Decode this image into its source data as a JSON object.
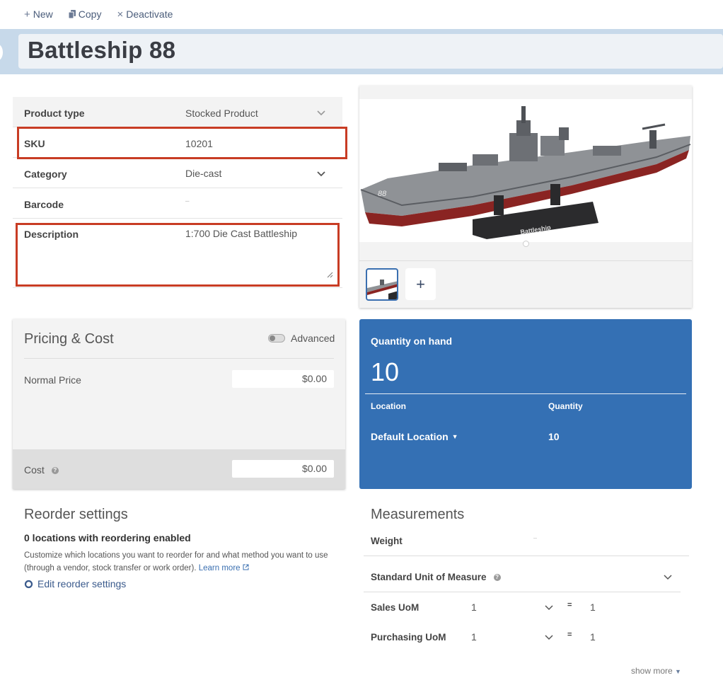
{
  "toolbar": {
    "new_label": "New",
    "copy_label": "Copy",
    "deactivate_label": "Deactivate"
  },
  "product": {
    "title": "Battleship 88"
  },
  "details": {
    "product_type_label": "Product type",
    "product_type_value": "Stocked Product",
    "sku_label": "SKU",
    "sku_value": "10201",
    "category_label": "Category",
    "category_value": "Die-cast",
    "barcode_label": "Barcode",
    "barcode_value": "–",
    "description_label": "Description",
    "description_value": "1:700 Die Cast Battleship"
  },
  "image_card": {
    "hull_text": "88",
    "stand_text": "Battleship",
    "add_label": "+"
  },
  "pricing": {
    "title": "Pricing & Cost",
    "advanced_label": "Advanced",
    "advanced_on": false,
    "normal_price_label": "Normal Price",
    "normal_price_value": "$0.00",
    "cost_label": "Cost",
    "cost_value": "$0.00",
    "help_glyph": "?"
  },
  "quantity": {
    "title": "Quantity on hand",
    "total": "10",
    "location_header": "Location",
    "quantity_header": "Quantity",
    "rows": [
      {
        "location": "Default Location",
        "quantity": "10"
      }
    ]
  },
  "reorder": {
    "title": "Reorder settings",
    "subtitle": "0 locations with reordering enabled",
    "description": "Customize which locations you want to reorder for and what method you want to use (through a vendor, stock transfer or work order).",
    "learn_more": "Learn more",
    "edit_label": "Edit reorder settings"
  },
  "measurements": {
    "title": "Measurements",
    "weight_label": "Weight",
    "weight_value": "–",
    "standard_uom_label": "Standard Unit of Measure",
    "sales_uom_label": "Sales UoM",
    "sales_uom_value": "1",
    "sales_uom_ratio": "1",
    "purchasing_uom_label": "Purchasing UoM",
    "purchasing_uom_value": "1",
    "purchasing_uom_ratio": "1",
    "equals": "=",
    "show_more": "show more"
  },
  "colors": {
    "accent_blue": "#3470b4",
    "highlight_red": "#c83c24",
    "title_band": "#c7d9ea"
  }
}
